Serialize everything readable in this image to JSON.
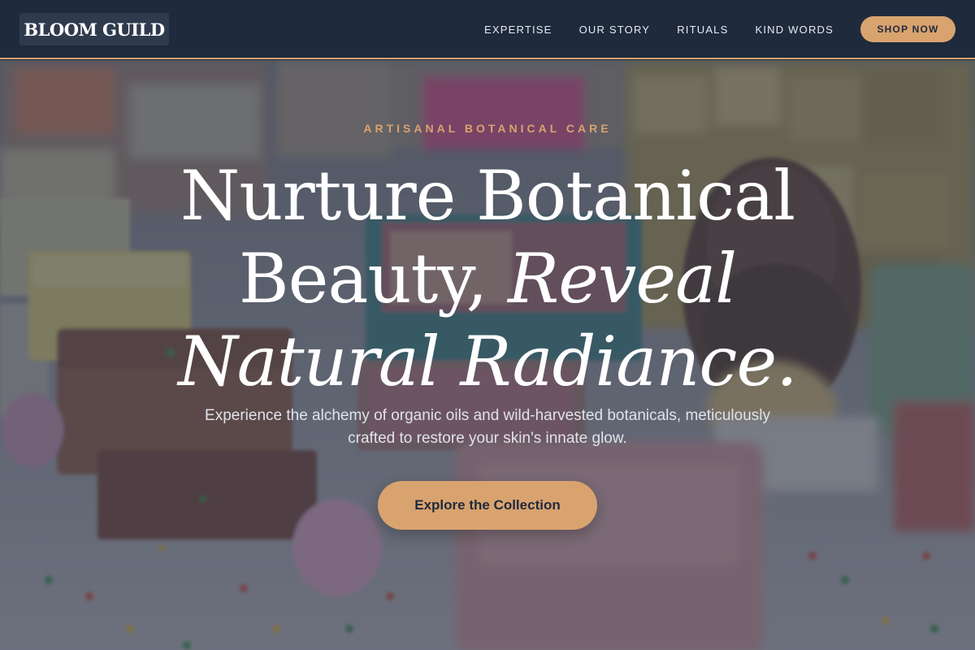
{
  "header": {
    "logo": "BLOOM GUILD",
    "nav": [
      {
        "label": "EXPERTISE"
      },
      {
        "label": "OUR STORY"
      },
      {
        "label": "RITUALS"
      },
      {
        "label": "KIND WORDS"
      }
    ],
    "cta_label": "SHOP NOW"
  },
  "hero": {
    "eyebrow": "ARTISANAL BOTANICAL CARE",
    "headline_line1": "Nurture Botanical",
    "headline_line2_plain": "Beauty, ",
    "headline_line2_italic": "Reveal",
    "headline_line3_italic": "Natural Radiance.",
    "subtext": "Experience the alchemy of organic oils and wild-harvested botanicals, meticulously crafted to restore your skin's innate glow.",
    "cta_label": "Explore the Collection"
  },
  "colors": {
    "header_bg": "#1f2a3c",
    "accent": "#d9a36f",
    "text_light": "#ffffff"
  }
}
